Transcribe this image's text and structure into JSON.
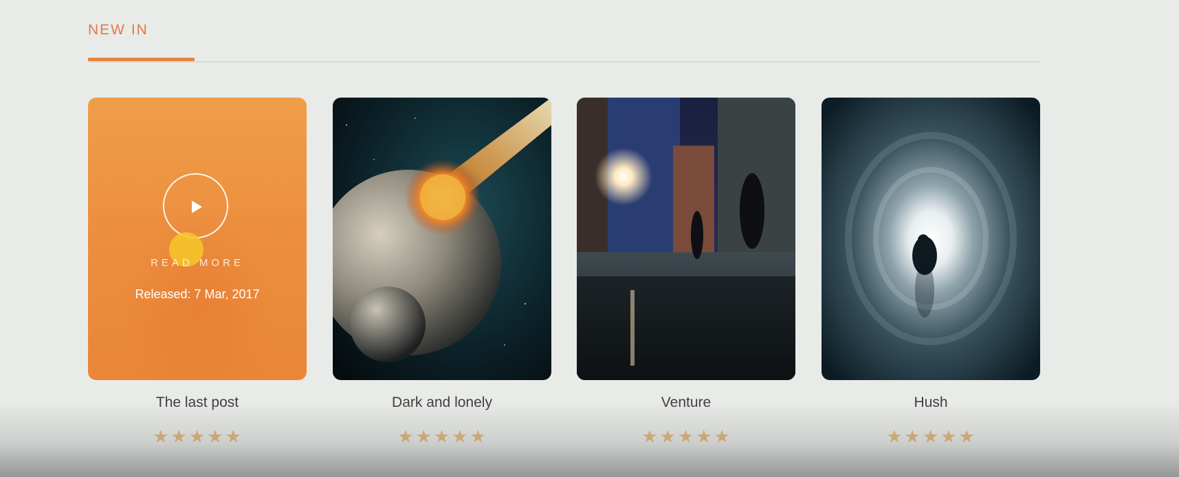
{
  "section": {
    "title": "NEW IN"
  },
  "cards": [
    {
      "title": "The last post",
      "image": "orange-overlay",
      "overlay": {
        "read_more": "READ MORE",
        "released": "Released: 7 Mar, 2017",
        "play_icon": "play-icon"
      },
      "rating": 5
    },
    {
      "title": "Dark and lonely",
      "image": "planet-collision",
      "rating": 5
    },
    {
      "title": "Venture",
      "image": "city-alley-night",
      "rating": 5
    },
    {
      "title": "Hush",
      "image": "tunnel-light",
      "rating": 5
    }
  ],
  "colors": {
    "accent": "#e8843f",
    "title_accent": "#e07b45",
    "star": "#e0a455"
  },
  "star_glyph": "★"
}
